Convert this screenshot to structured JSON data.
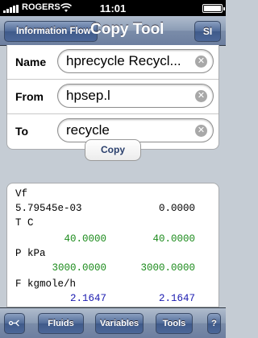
{
  "status_bar": {
    "carrier": "ROGERS",
    "time": "11:01",
    "battery_level": 1.0,
    "icons": [
      "signal-bars-icon",
      "wifi-icon",
      "battery-icon"
    ]
  },
  "nav": {
    "back_label": "Information Flow",
    "title": "Copy Tool",
    "unit_button": "SI"
  },
  "form": {
    "name_label": "Name",
    "name_value": "hprecycle Recycl...",
    "from_label": "From",
    "from_value": "hpsep.l",
    "to_label": "To",
    "to_value": "recycle",
    "copy_label": "Copy"
  },
  "results": {
    "vf_label": "Vf",
    "vf_values": [
      "5.79545e-03",
      "0.0000"
    ],
    "t_label": "T C",
    "t_values": [
      "40.0000",
      "40.0000"
    ],
    "p_label": "P kPa",
    "p_values": [
      "3000.0000",
      "3000.0000"
    ],
    "f_label": "F kgmole/h",
    "f_values": [
      "2.1647",
      "2.1647"
    ]
  },
  "toolbar": {
    "fluids_label": "Fluids",
    "variables_label": "Variables",
    "tools_label": "Tools",
    "help_label": "?"
  },
  "colors": {
    "calculated_green": "#1a8a1a",
    "specified_blue": "#1a1ab0",
    "bar_blue": "#6d7fa0"
  }
}
